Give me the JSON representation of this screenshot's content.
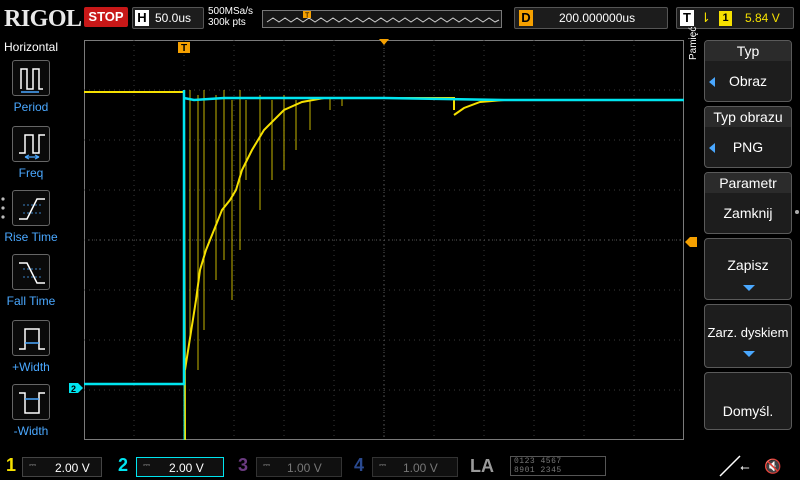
{
  "topbar": {
    "brand": "RIGOL",
    "run_state": "STOP",
    "horizontal": {
      "key": "H",
      "scale": "50.0us"
    },
    "sample_rate": "500MSa/s",
    "memory_depth": "300k pts",
    "delay": {
      "key": "D",
      "value": "200.000000us"
    },
    "trigger": {
      "key": "T",
      "edge_symbol": "⇂",
      "source": "1",
      "level": "5.84 V"
    }
  },
  "left_panel": {
    "title": "Horizontal",
    "items": [
      {
        "label": "Period",
        "icon": "period-icon"
      },
      {
        "label": "Freq",
        "icon": "frequency-icon"
      },
      {
        "label": "Rise Time",
        "icon": "rise-time-icon"
      },
      {
        "label": "Fall Time",
        "icon": "fall-time-icon"
      },
      {
        "label": "+Width",
        "icon": "positive-width-icon"
      },
      {
        "label": "-Width",
        "icon": "negative-width-icon"
      }
    ]
  },
  "right_menu": {
    "side_label": "Pamięć",
    "buttons": [
      {
        "header": "Typ",
        "value": "Obraz"
      },
      {
        "header": "Typ obrazu",
        "value": "PNG"
      },
      {
        "header": "Parametr",
        "value": "Zamknij"
      },
      {
        "value": "Zapisz"
      },
      {
        "value": "Zarz. dyskiem"
      },
      {
        "value": "Domyśl."
      }
    ]
  },
  "markers": {
    "trigger_marker": "T",
    "ch2_marker": "2"
  },
  "channels": [
    {
      "num": "1",
      "scale": "2.00 V",
      "color": "#f5e000",
      "active": true
    },
    {
      "num": "2",
      "scale": "2.00 V",
      "color": "#00e5f0",
      "active": true
    },
    {
      "num": "3",
      "scale": "1.00 V",
      "color": "#b040d0",
      "active": false
    },
    {
      "num": "4",
      "scale": "1.00 V",
      "color": "#2060e0",
      "active": false
    }
  ],
  "la": {
    "label": "LA",
    "row1": "0123 4567",
    "row2": "8901 2345"
  },
  "colors": {
    "ch1": "#f5e000",
    "ch2": "#00e5f0",
    "accent": "#4aa8ff",
    "trigger": "#f5a000",
    "stop": "#c81818"
  }
}
